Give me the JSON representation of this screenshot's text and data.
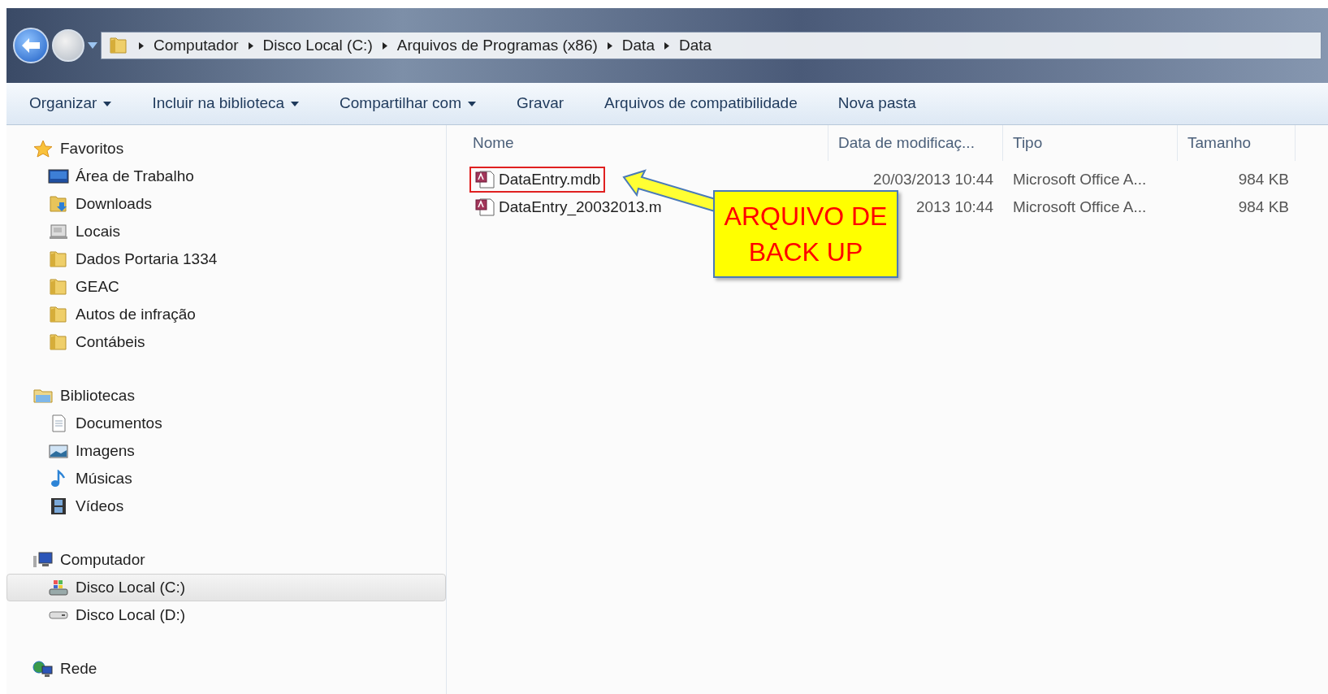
{
  "address_bar": {
    "path": [
      "Computador",
      "Disco Local (C:)",
      "Arquivos de Programas (x86)",
      "Data",
      "Data"
    ]
  },
  "toolbar": [
    {
      "label": "Organizar",
      "dropdown": true
    },
    {
      "label": "Incluir na biblioteca",
      "dropdown": true
    },
    {
      "label": "Compartilhar com",
      "dropdown": true
    },
    {
      "label": "Gravar",
      "dropdown": false
    },
    {
      "label": "Arquivos de compatibilidade",
      "dropdown": false
    },
    {
      "label": "Nova pasta",
      "dropdown": false
    }
  ],
  "sidebar": {
    "groups": [
      {
        "label": "Favoritos",
        "children": [
          {
            "label": "Área de Trabalho",
            "selected": false
          },
          {
            "label": "Downloads",
            "selected": false
          },
          {
            "label": "Locais",
            "selected": false
          },
          {
            "label": "Dados Portaria 1334",
            "selected": false
          },
          {
            "label": "GEAC",
            "selected": false
          },
          {
            "label": "Autos de infração",
            "selected": false
          },
          {
            "label": "Contábeis",
            "selected": false
          }
        ]
      },
      {
        "label": "Bibliotecas",
        "children": [
          {
            "label": "Documentos",
            "selected": false
          },
          {
            "label": "Imagens",
            "selected": false
          },
          {
            "label": "Músicas",
            "selected": false
          },
          {
            "label": "Vídeos",
            "selected": false
          }
        ]
      },
      {
        "label": "Computador",
        "children": [
          {
            "label": "Disco Local (C:)",
            "selected": true
          },
          {
            "label": "Disco Local (D:)",
            "selected": false
          }
        ]
      },
      {
        "label": "Rede"
      }
    ]
  },
  "table": {
    "columns": [
      "Nome",
      "Data de modificaç...",
      "Tipo",
      "Tamanho"
    ],
    "rows": [
      {
        "name": "DataEntry.mdb",
        "date": "20/03/2013 10:44",
        "type": "Microsoft Office A...",
        "size": "984 KB",
        "highlighted": true
      },
      {
        "name": "DataEntry_20032013.m",
        "date": "2013 10:44",
        "type": "Microsoft Office A...",
        "size": "984 KB",
        "highlighted": false
      }
    ]
  },
  "callout": {
    "lines": [
      "ARQUIVO DE",
      "BACK UP"
    ]
  }
}
